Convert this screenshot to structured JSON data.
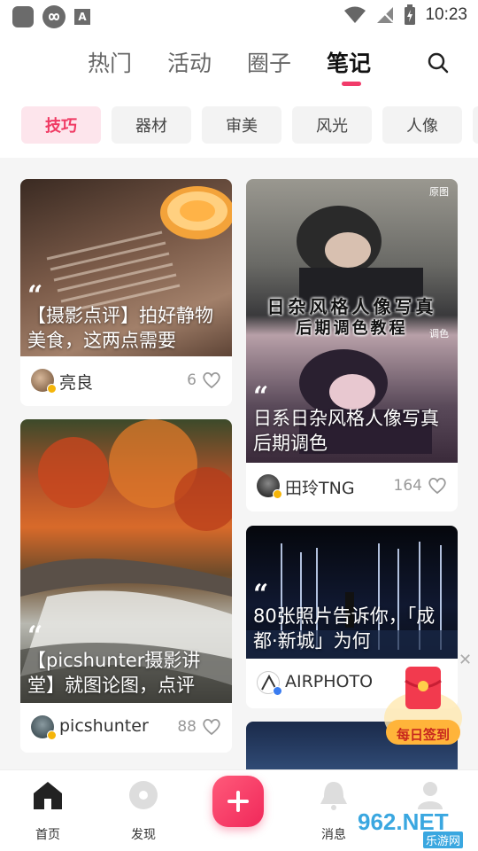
{
  "status_bar": {
    "time": "10:23"
  },
  "top_tabs": [
    {
      "label": "热门",
      "active": false
    },
    {
      "label": "活动",
      "active": false
    },
    {
      "label": "圈子",
      "active": false
    },
    {
      "label": "笔记",
      "active": true
    }
  ],
  "chips": [
    {
      "label": "技巧",
      "active": true
    },
    {
      "label": "器材",
      "active": false
    },
    {
      "label": "审美",
      "active": false
    },
    {
      "label": "风光",
      "active": false
    },
    {
      "label": "人像",
      "active": false
    }
  ],
  "cards": [
    {
      "title": "【摄影点评】拍好静物美食，这两点需要",
      "author": "亮良",
      "likes": "6"
    },
    {
      "title": "【picshunter摄影讲堂】就图论图，点评",
      "author": "picshunter",
      "likes": "88"
    },
    {
      "title": "日系日杂风格人像写真后期调色",
      "author": "田玲TNG",
      "likes": "164",
      "overlay_line1": "日杂风格人像写真",
      "overlay_line2": "后期调色教程",
      "tag_original": "原图",
      "tag_graded": "调色"
    },
    {
      "title": "80张照片告诉你，「成都·新城」为何",
      "author": "AIRPHOTO",
      "likes": ""
    }
  ],
  "checkin": {
    "label": "每日签到"
  },
  "bottom_nav": [
    {
      "label": "首页",
      "icon": "home-icon"
    },
    {
      "label": "发现",
      "icon": "discover-icon"
    },
    {
      "label": "",
      "icon": "plus-icon"
    },
    {
      "label": "消息",
      "icon": "bell-icon"
    },
    {
      "label": "",
      "icon": "profile-icon"
    }
  ],
  "watermark": {
    "main": "962.NET",
    "sub": "乐游网"
  },
  "colors": {
    "accent": "#f13b6a",
    "chip_active_bg": "#fde5ec"
  }
}
